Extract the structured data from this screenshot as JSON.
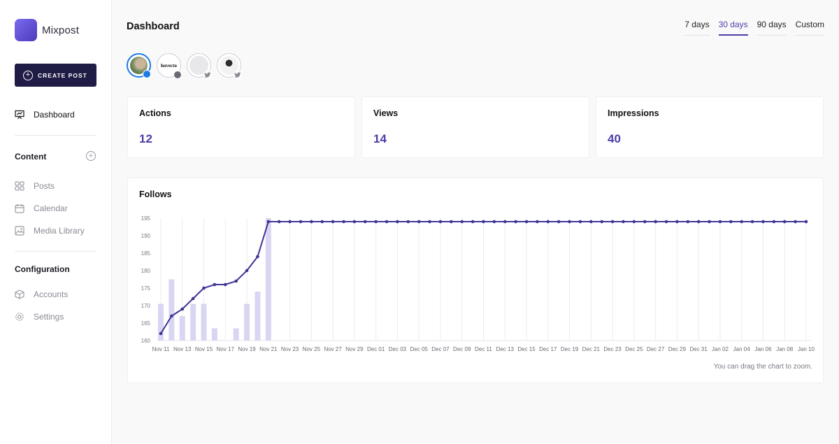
{
  "app": {
    "name": "Mixpost"
  },
  "sidebar": {
    "create_label": "CREATE POST",
    "dashboard_label": "Dashboard",
    "content_title": "Content",
    "content_items": [
      {
        "label": "Posts",
        "icon": "posts-icon"
      },
      {
        "label": "Calendar",
        "icon": "calendar-icon"
      },
      {
        "label": "Media Library",
        "icon": "media-icon"
      }
    ],
    "configuration_title": "Configuration",
    "configuration_items": [
      {
        "label": "Accounts",
        "icon": "accounts-icon"
      },
      {
        "label": "Settings",
        "icon": "settings-icon"
      }
    ]
  },
  "header": {
    "title": "Dashboard",
    "ranges": [
      "7 days",
      "30 days",
      "90 days",
      "Custom"
    ],
    "active_range": "30 days"
  },
  "accounts": [
    {
      "platform": "facebook",
      "avatar": "photo-avatar",
      "selected": true
    },
    {
      "platform": "facebook",
      "avatar": "text-avatar",
      "avatar_text": "hovecto",
      "selected": false
    },
    {
      "platform": "twitter",
      "avatar": "blank-avatar",
      "selected": false
    },
    {
      "platform": "twitter",
      "avatar": "person-avatar",
      "selected": false
    }
  ],
  "stats": [
    {
      "title": "Actions",
      "value": "12"
    },
    {
      "title": "Views",
      "value": "14"
    },
    {
      "title": "Impressions",
      "value": "40"
    }
  ],
  "follows_card": {
    "title": "Follows",
    "hint": "You can drag the chart to zoom."
  },
  "colors": {
    "accent": "#4b3ea8",
    "bar": "#d9d6f3",
    "line": "#3f3596",
    "sidebar_button": "#1f1c45",
    "facebook": "#1d79e6",
    "twitter_badge": "#8a8a94"
  },
  "chart_data": {
    "type": "line",
    "ylim": [
      160,
      195
    ],
    "y_ticks": [
      160,
      165,
      170,
      175,
      180,
      185,
      190,
      195
    ],
    "x_labels": [
      "Nov 11",
      "Nov 13",
      "Nov 15",
      "Nov 17",
      "Nov 19",
      "Nov 21",
      "Nov 23",
      "Nov 25",
      "Nov 27",
      "Nov 29",
      "Dec 01",
      "Dec 03",
      "Dec 05",
      "Dec 07",
      "Dec 09",
      "Dec 11",
      "Dec 13",
      "Dec 15",
      "Dec 17",
      "Dec 19",
      "Dec 21",
      "Dec 23",
      "Dec 25",
      "Dec 27",
      "Dec 29",
      "Dec 31",
      "Jan 02",
      "Jan 04",
      "Jan 06",
      "Jan 08",
      "Jan 10"
    ],
    "x_dates": [
      "Nov 11",
      "Nov 12",
      "Nov 13",
      "Nov 14",
      "Nov 15",
      "Nov 16",
      "Nov 17",
      "Nov 18",
      "Nov 19",
      "Nov 20",
      "Nov 21",
      "Nov 22",
      "Nov 23",
      "Nov 24",
      "Nov 25",
      "Nov 26",
      "Nov 27",
      "Nov 28",
      "Nov 29",
      "Nov 30",
      "Dec 01",
      "Dec 02",
      "Dec 03",
      "Dec 04",
      "Dec 05",
      "Dec 06",
      "Dec 07",
      "Dec 08",
      "Dec 09",
      "Dec 10",
      "Dec 11",
      "Dec 12",
      "Dec 13",
      "Dec 14",
      "Dec 15",
      "Dec 16",
      "Dec 17",
      "Dec 18",
      "Dec 19",
      "Dec 20",
      "Dec 21",
      "Dec 22",
      "Dec 23",
      "Dec 24",
      "Dec 25",
      "Dec 26",
      "Dec 27",
      "Dec 28",
      "Dec 29",
      "Dec 30",
      "Dec 31",
      "Jan 01",
      "Jan 02",
      "Jan 03",
      "Jan 04",
      "Jan 05",
      "Jan 06",
      "Jan 07",
      "Jan 08",
      "Jan 09",
      "Jan 10"
    ],
    "series": [
      {
        "type": "line",
        "values": [
          162,
          167,
          169,
          172,
          175,
          176,
          176,
          177,
          180,
          184,
          194,
          194,
          194,
          194,
          194,
          194,
          194,
          194,
          194,
          194,
          194,
          194,
          194,
          194,
          194,
          194,
          194,
          194,
          194,
          194,
          194,
          194,
          194,
          194,
          194,
          194,
          194,
          194,
          194,
          194,
          194,
          194,
          194,
          194,
          194,
          194,
          194,
          194,
          194,
          194,
          194,
          194,
          194,
          194,
          194,
          194,
          194,
          194,
          194,
          194,
          194
        ]
      },
      {
        "type": "bar",
        "values": [
          170.5,
          177.5,
          167,
          170.5,
          170.5,
          163.5,
          0,
          163.5,
          170.5,
          174,
          195,
          0,
          0,
          0,
          0,
          0,
          0,
          0,
          0,
          0,
          0,
          0,
          0,
          0,
          0,
          0,
          0,
          0,
          0,
          0,
          0,
          0,
          0,
          0,
          0,
          0,
          0,
          0,
          0,
          0,
          0,
          0,
          0,
          0,
          0,
          0,
          0,
          0,
          0,
          0,
          0,
          0,
          0,
          0,
          0,
          0,
          0,
          0,
          0,
          0,
          0
        ]
      }
    ],
    "grid": "vertical"
  }
}
